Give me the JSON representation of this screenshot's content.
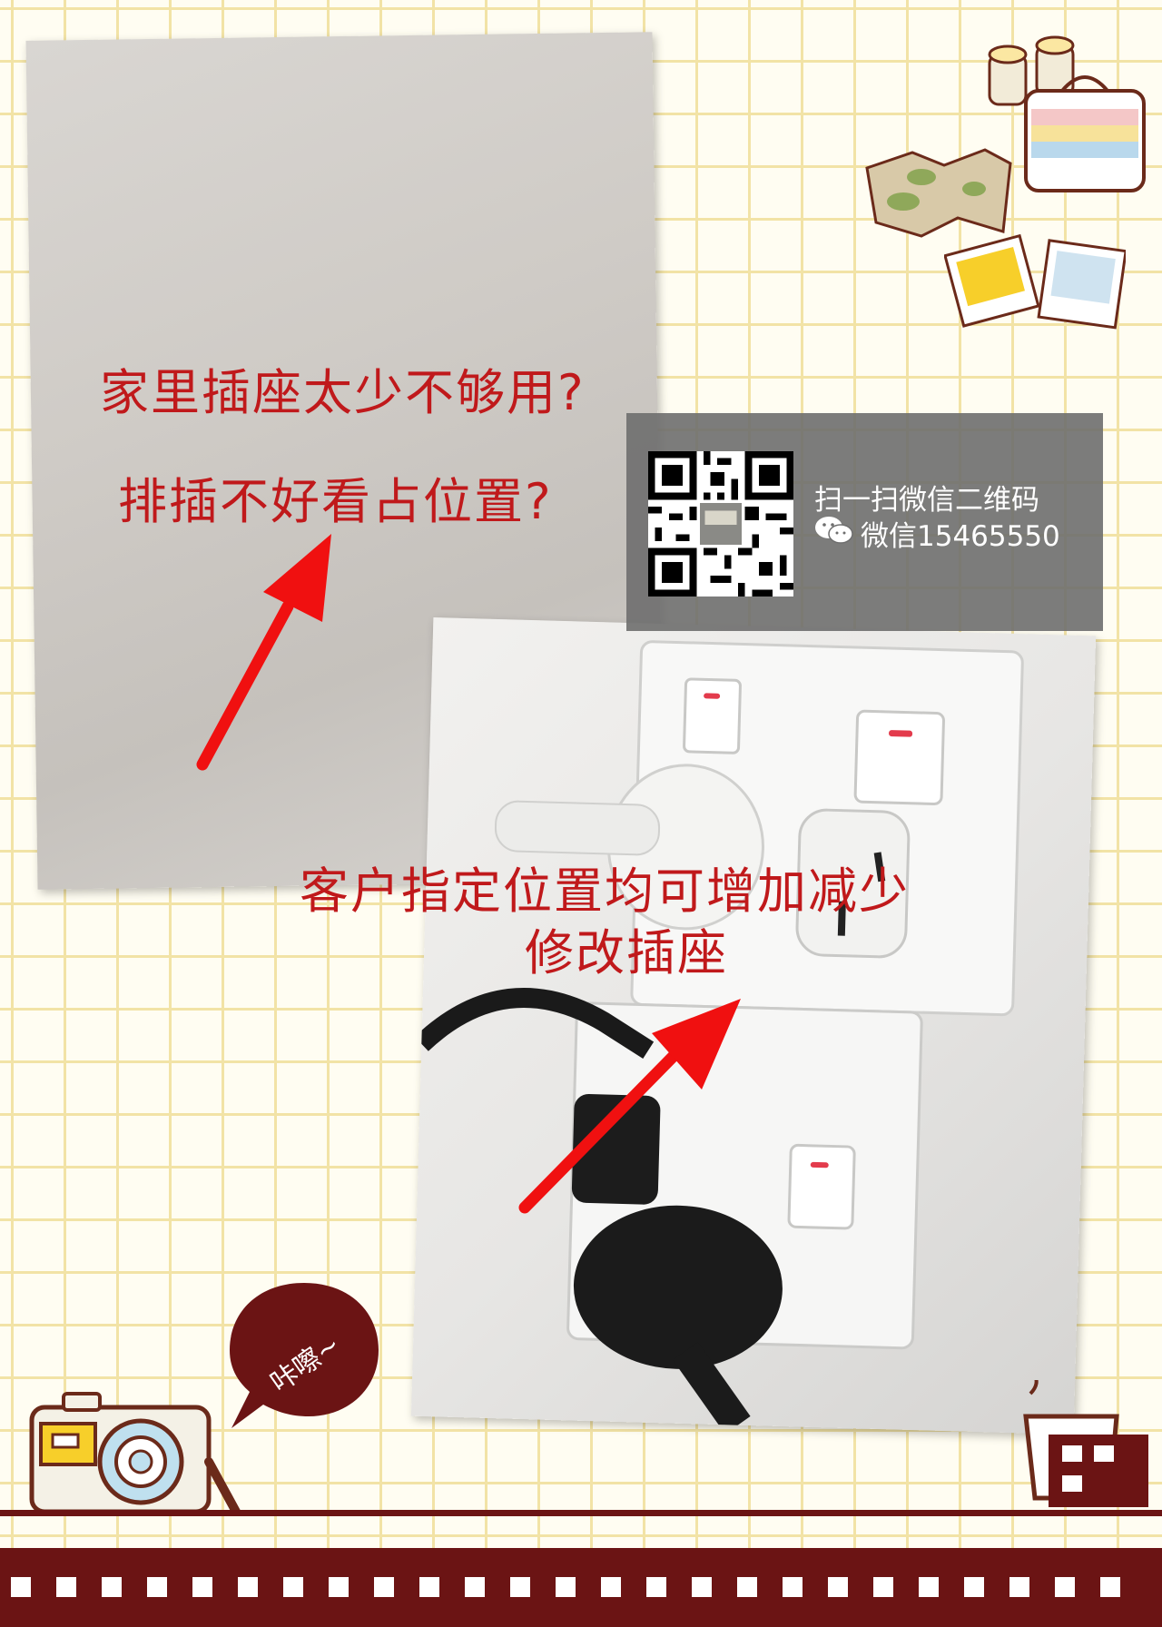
{
  "headlines": {
    "question_1": "家里插座太少不够用?",
    "question_2": "排插不好看占位置?",
    "claim_line_1": "客户指定位置均可增加减少",
    "claim_line_2": "修改插座"
  },
  "qr_panel": {
    "caption": "扫一扫微信二维码",
    "wechat_id": "微信15465550"
  },
  "speech_bubble": {
    "text": "咔嚓~"
  },
  "icons": {
    "wechat": "wechat-icon",
    "camera": "camera-icon",
    "binoculars": "binoculars-icon",
    "map": "map-icon",
    "suitcase": "suitcase-icon",
    "polaroids": "polaroid-icon",
    "coffee": "coffee-cup-icon"
  },
  "colors": {
    "headline_red": "#c0191b",
    "arrow_red": "#f01010",
    "film_maroon": "#6b1414",
    "grid_yellow": "#f2e3a6"
  }
}
